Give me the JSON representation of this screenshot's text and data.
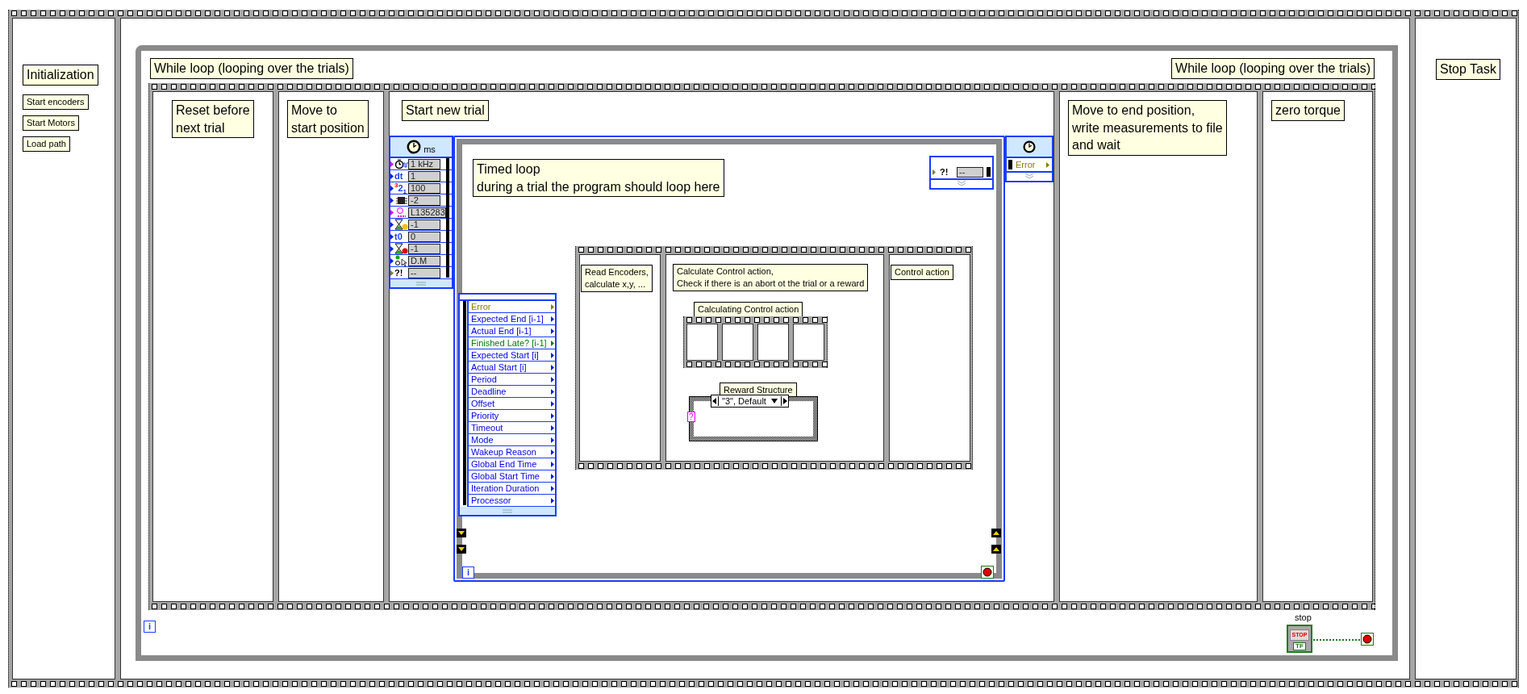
{
  "initialization_frame": {
    "title": "Initialization",
    "steps": [
      "Start encoders",
      "Start Motors",
      "Load path"
    ]
  },
  "trial_loop": {
    "labels": [
      "While loop (looping over the trials)",
      "While loop (looping over the trials)"
    ],
    "frames": [
      {
        "kind": "plain",
        "label": "Reset before\nnext trial"
      },
      {
        "kind": "plain",
        "label": "Move to\nstart position"
      },
      {
        "kind": "timed",
        "label": "Start new trial"
      },
      {
        "kind": "plain",
        "label": "Move to end position,\nwrite measurements to file\nand wait"
      },
      {
        "kind": "plain",
        "label": "zero torque"
      }
    ],
    "iteration_terminal": "i",
    "stop_button": {
      "label": "stop",
      "text": "STOP",
      "type": "TF"
    }
  },
  "timed_loop": {
    "label": "Timed loop\nduring a trial the program should loop here",
    "config_node": {
      "unit": "ms",
      "inputs": [
        {
          "kind": "timing",
          "value": "1 kHz"
        },
        {
          "kind": "number",
          "tag": "dt",
          "value": "1"
        },
        {
          "kind": "number",
          "tag": "$^{3}$2$_{1}$",
          "value": "100"
        },
        {
          "kind": "number",
          "value": "-2"
        },
        {
          "kind": "timing",
          "value": "L135283"
        },
        {
          "kind": "number",
          "value": "-1"
        },
        {
          "kind": "number",
          "tag": "t0",
          "value": "0"
        },
        {
          "kind": "number",
          "value": "-1"
        },
        {
          "kind": "number",
          "value": "D.M"
        },
        {
          "kind": "error",
          "tag": "?!",
          "value": "--"
        }
      ]
    },
    "left_data_node": [
      {
        "kind": "error",
        "text": "Error"
      },
      {
        "kind": "number",
        "text": "Expected End [i-1]"
      },
      {
        "kind": "number",
        "text": "Actual End [i-1]"
      },
      {
        "kind": "boolean",
        "text": "Finished Late? [i-1]"
      },
      {
        "kind": "number",
        "text": "Expected Start [i]"
      },
      {
        "kind": "number",
        "text": "Actual Start [i]"
      },
      {
        "kind": "number",
        "text": "Period"
      },
      {
        "kind": "number",
        "text": "Deadline"
      },
      {
        "kind": "number",
        "text": "Offset"
      },
      {
        "kind": "number",
        "text": "Priority"
      },
      {
        "kind": "number",
        "text": "Timeout"
      },
      {
        "kind": "number",
        "text": "Mode"
      },
      {
        "kind": "number",
        "text": "Wakeup Reason"
      },
      {
        "kind": "number",
        "text": "Global End Time"
      },
      {
        "kind": "number",
        "text": "Global Start Time"
      },
      {
        "kind": "number",
        "text": "Iteration Duration"
      },
      {
        "kind": "number",
        "text": "Processor"
      }
    ],
    "right_input_node": {
      "kind": "error",
      "tag": "?!",
      "value": "--"
    },
    "output_node": {
      "kind": "error",
      "text": "Error"
    },
    "iteration_terminal": "i",
    "frames": [
      {
        "kind": "plain",
        "label": "Read Encoders,\ncalculate x,y, ..."
      },
      {
        "kind": "control",
        "label": "Calculate Control action,\nCheck if there is an abort ot the trial or a reward"
      },
      {
        "kind": "plain",
        "label": "Control action"
      }
    ],
    "control_sequence": {
      "label": "Calculating Control action"
    },
    "reward_case": {
      "label": "Reward Structure",
      "selector": "\"3\", Default",
      "terminal": "?"
    }
  },
  "stop_task_frame": {
    "title": "Stop Task"
  }
}
